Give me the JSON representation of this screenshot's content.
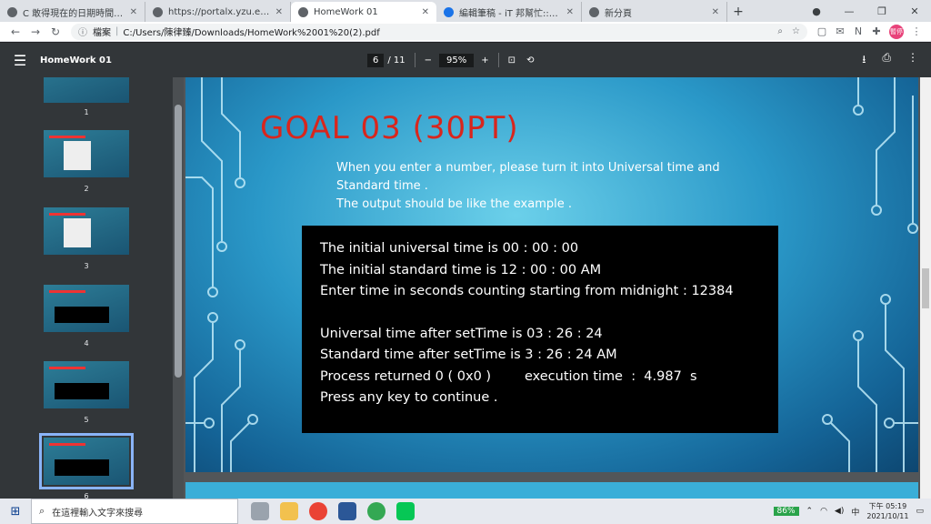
{
  "browser": {
    "tabs": [
      {
        "title": "C 敢得現在的日期時間 @ 數位",
        "active": false
      },
      {
        "title": "https://portalx.yzu.edu.tw/Port",
        "active": false
      },
      {
        "title": "HomeWork 01",
        "active": true
      },
      {
        "title": "編輯筆稿 - iT 邦幫忙::一起幫忙",
        "active": false
      },
      {
        "title": "新分頁",
        "active": false
      }
    ],
    "new_tab": "+",
    "url_prefix": "檔案",
    "url": "C:/Users/陳律臻/Downloads/HomeWork%2001%20(2).pdf",
    "avatar_label": "暫停"
  },
  "pdf": {
    "title": "HomeWork 01",
    "page_current": "6",
    "page_total": "/ 11",
    "zoom": "95%",
    "zoom_out": "−",
    "zoom_in": "+"
  },
  "thumbnails": [
    "1",
    "2",
    "3",
    "4",
    "5",
    "6"
  ],
  "slide": {
    "heading": "GOAL 03 (30PT)",
    "desc_lines": [
      "When you enter a number, please turn it into Universal time and",
      "Standard time .",
      "The output should be like the example ."
    ],
    "console_lines": [
      "The initial universal time is 00 : 00 : 00",
      "The initial standard time is 12 : 00 : 00 AM",
      "Enter time in seconds counting starting from midnight : 12384",
      "",
      "Universal time after setTime is 03 : 26 : 24",
      "Standard time after setTime is 3 : 26 : 24 AM",
      "Process returned 0 ( 0x0 )        execution time  :  4.987  s",
      "Press any key to continue ."
    ]
  },
  "taskbar": {
    "search_placeholder": "在這裡輸入文字來搜尋",
    "battery": "86%",
    "ime": "中",
    "time": "下午 05:19",
    "date": "2021/10/11"
  }
}
